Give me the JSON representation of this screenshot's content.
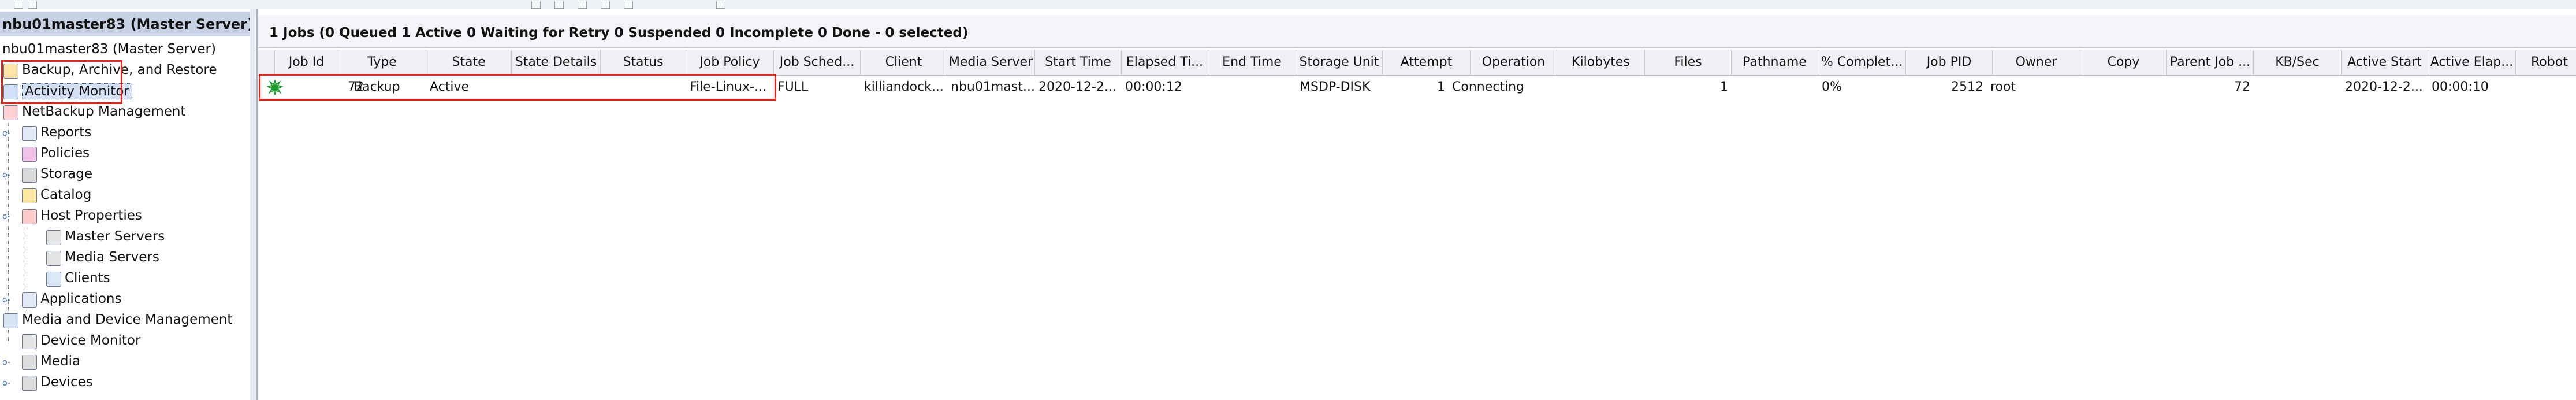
{
  "tree": {
    "server_header": "nbu01master83 (Master Server)",
    "items": [
      {
        "label": "nbu01master83 (Master Server)",
        "indent": 0
      },
      {
        "label": "Backup, Archive, and Restore",
        "indent": 1
      },
      {
        "label": "Activity Monitor",
        "indent": 1
      },
      {
        "label": "NetBackup Management",
        "indent": 1
      },
      {
        "label": "Reports",
        "indent": 2
      },
      {
        "label": "Policies",
        "indent": 2
      },
      {
        "label": "Storage",
        "indent": 2
      },
      {
        "label": "Catalog",
        "indent": 2
      },
      {
        "label": "Host Properties",
        "indent": 2
      },
      {
        "label": "Master Servers",
        "indent": 3
      },
      {
        "label": "Media Servers",
        "indent": 3
      },
      {
        "label": "Clients",
        "indent": 3
      },
      {
        "label": "Applications",
        "indent": 2
      },
      {
        "label": "Media and Device Management",
        "indent": 1
      },
      {
        "label": "Device Monitor",
        "indent": 2
      },
      {
        "label": "Media",
        "indent": 2
      },
      {
        "label": "Devices",
        "indent": 2
      }
    ]
  },
  "summary": "1 Jobs (0 Queued 1 Active 0 Waiting for Retry 0 Suspended 0 Incomplete 0 Done - 0 selected)",
  "columns": [
    "Job Id",
    "Type",
    "State",
    "State Details",
    "Status",
    "Job Policy",
    "Job Sched...",
    "Client",
    "Media Server",
    "Start Time",
    "Elapsed Ti...",
    "End Time",
    "Storage Unit",
    "Attempt",
    "Operation",
    "Kilobytes",
    "Files",
    "Pathname",
    "% Complet...",
    "Job PID",
    "Owner",
    "Copy",
    "Parent Job ...",
    "KB/Sec",
    "Active Start",
    "Active Elap...",
    "Robot"
  ],
  "row": {
    "job_id": "72",
    "type": "Backup",
    "state": "Active",
    "state_details": "",
    "status": "",
    "job_policy": "File-Linux-...",
    "job_schedule": "FULL",
    "client": "killiandock...",
    "media_server": "nbu01mast...",
    "start_time": "2020-12-2...",
    "elapsed_time": "00:00:12",
    "end_time": "",
    "storage_unit": "MSDP-DISK",
    "attempt": "1",
    "operation": "Connecting",
    "kilobytes": "",
    "files": "1",
    "pathname": "",
    "percent_complete": "0%",
    "job_pid": "2512",
    "owner": "root",
    "copy": "",
    "parent_job": "72",
    "kb_sec": "",
    "active_start": "2020-12-2...",
    "active_elapsed": "00:00:10",
    "robot": ""
  },
  "icons": {
    "job_active": "running-job-icon"
  },
  "colors": {
    "highlight_red": "#e2231a",
    "header_blue": "#c7d2e5",
    "job_icon_green": "#1f9b2f"
  }
}
